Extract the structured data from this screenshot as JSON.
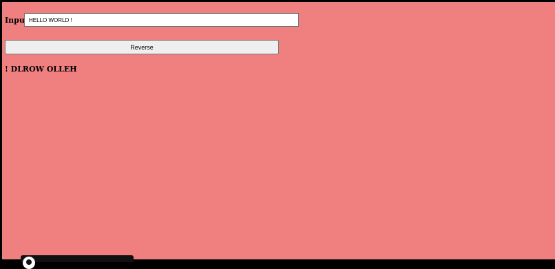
{
  "form": {
    "input_label": "Input",
    "input_value": "HELLO WORLD !",
    "button_label": "Reverse"
  },
  "output": {
    "text": "! DLROW OLLEH"
  },
  "colors": {
    "page_background": "#f08080",
    "frame": "#000000",
    "button_background": "#efefef"
  }
}
